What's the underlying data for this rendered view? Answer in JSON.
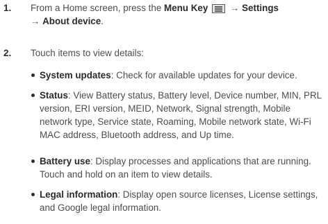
{
  "steps": [
    {
      "number": "1.",
      "line1_prefix": "From a Home screen, press the ",
      "menu_key_label": "Menu Key",
      "arrow1": "→",
      "settings_label": "Settings",
      "arrow2": "→",
      "about_label": "About device",
      "period": "."
    },
    {
      "number": "2.",
      "text": "Touch items to view details:"
    }
  ],
  "items": [
    {
      "title": "System updates",
      "desc": ": Check for available updates for your device."
    },
    {
      "title": "Status",
      "desc": ": View Battery status, Battery level, Device number, MIN, PRL version, ERI version, MEID, Network, Signal strength, Mobile network type, Service state, Roaming, Mobile network state, Wi-Fi MAC address, Bluetooth address, and Up time."
    },
    {
      "title": "Battery use",
      "desc": ": Display processes and applications that are running. Touch and hold on an item to view details."
    },
    {
      "title": "Legal information",
      "desc": ": Display open source licenses, License settings, and Google legal information."
    }
  ],
  "icons": {
    "menu_key": "menu-key-icon"
  },
  "colors": {
    "text": "#4d4d4d",
    "bold": "#2b2b2b"
  }
}
